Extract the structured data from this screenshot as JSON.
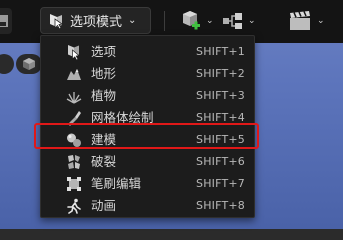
{
  "toolbar": {
    "mode_button": {
      "label": "选项模式",
      "icon": "selection-mode-icon"
    },
    "groups": [
      {
        "icon": "add-actor-icon"
      },
      {
        "icon": "blueprint-icon"
      },
      {
        "icon": "cinematics-icon"
      }
    ]
  },
  "mode_menu": {
    "items": [
      {
        "label": "选项",
        "shortcut": "SHIFT+1",
        "icon": "select-cursor-icon"
      },
      {
        "label": "地形",
        "shortcut": "SHIFT+2",
        "icon": "landscape-icon"
      },
      {
        "label": "植物",
        "shortcut": "SHIFT+3",
        "icon": "foliage-icon"
      },
      {
        "label": "网格体绘制",
        "shortcut": "SHIFT+4",
        "icon": "mesh-paint-icon"
      },
      {
        "label": "建模",
        "shortcut": "SHIFT+5",
        "icon": "modeling-icon"
      },
      {
        "label": "破裂",
        "shortcut": "SHIFT+6",
        "icon": "fracture-icon"
      },
      {
        "label": "笔刷编辑",
        "shortcut": "SHIFT+7",
        "icon": "brush-edit-icon"
      },
      {
        "label": "动画",
        "shortcut": "SHIFT+8",
        "icon": "animation-icon"
      }
    ],
    "highlighted_index": 4
  },
  "colors": {
    "highlight": "#e01818",
    "accent_green": "#3fbf3f",
    "viewport_blue": "#5d75bc"
  }
}
